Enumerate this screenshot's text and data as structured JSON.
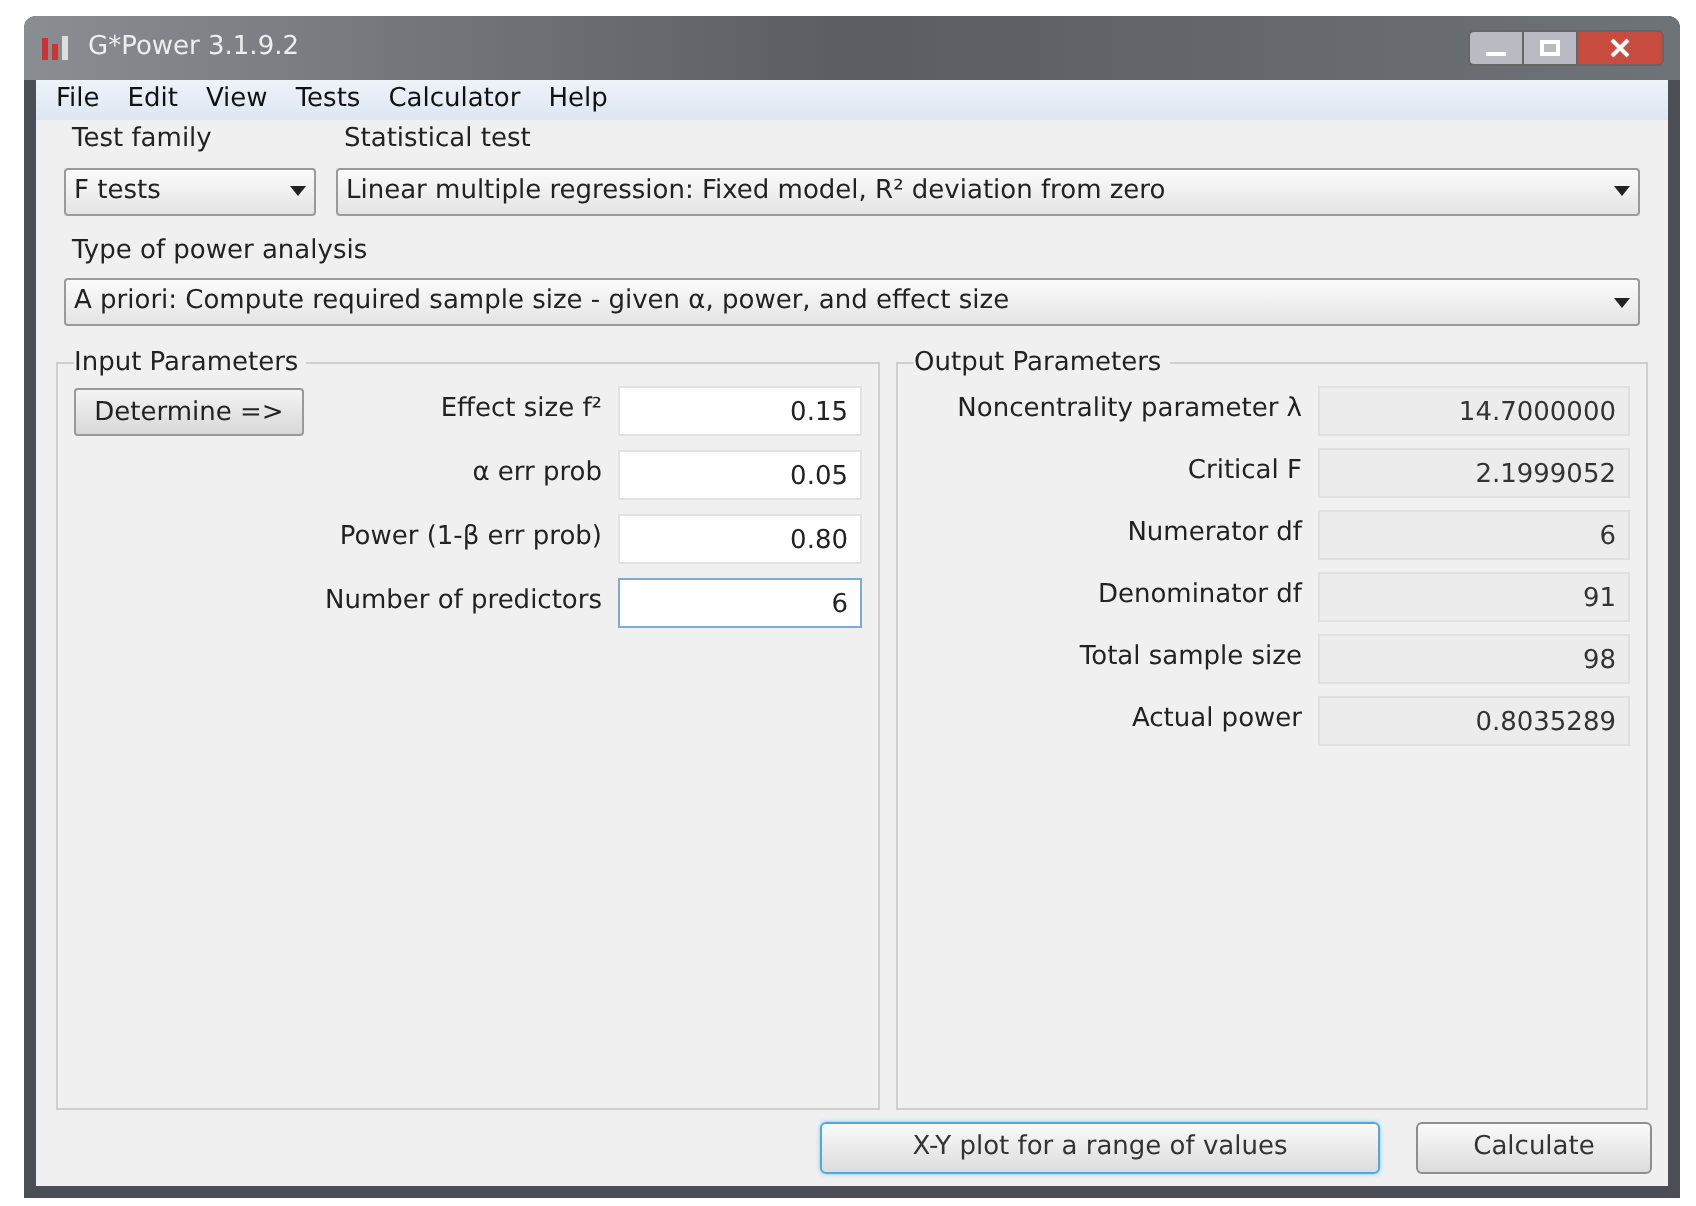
{
  "window": {
    "title": "G*Power 3.1.9.2"
  },
  "menu": [
    "File",
    "Edit",
    "View",
    "Tests",
    "Calculator",
    "Help"
  ],
  "test_family": {
    "label": "Test family",
    "value": "F tests"
  },
  "statistical_test": {
    "label": "Statistical test",
    "value": "Linear multiple regression: Fixed model, R² deviation from zero"
  },
  "power_analysis": {
    "label": "Type of power analysis",
    "value": "A priori: Compute required sample size - given α, power, and effect size"
  },
  "input_parameters": {
    "title": "Input Parameters",
    "determine_button": "Determine =>",
    "fields": [
      {
        "label": "Effect size f²",
        "value": "0.15",
        "focused": false
      },
      {
        "label": "α err prob",
        "value": "0.05",
        "focused": false
      },
      {
        "label": "Power (1-β err prob)",
        "value": "0.80",
        "focused": false
      },
      {
        "label": "Number of predictors",
        "value": "6",
        "focused": true
      }
    ]
  },
  "output_parameters": {
    "title": "Output Parameters",
    "fields": [
      {
        "label": "Noncentrality parameter λ",
        "value": "14.7000000"
      },
      {
        "label": "Critical F",
        "value": "2.1999052"
      },
      {
        "label": "Numerator df",
        "value": "6"
      },
      {
        "label": "Denominator df",
        "value": "91"
      },
      {
        "label": "Total sample size",
        "value": "98"
      },
      {
        "label": "Actual power",
        "value": "0.8035289"
      }
    ]
  },
  "buttons": [
    {
      "label": "X-Y plot for a range of values",
      "focused": true
    },
    {
      "label": "Calculate",
      "focused": false
    }
  ]
}
